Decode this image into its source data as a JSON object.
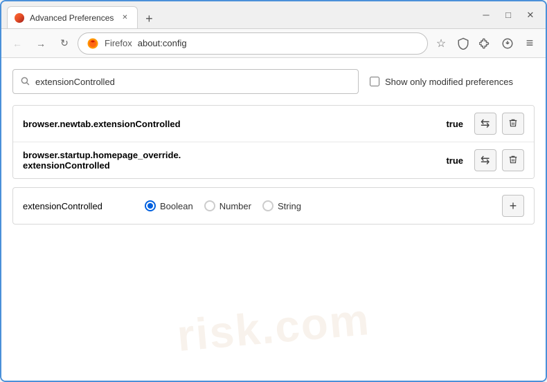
{
  "window": {
    "title": "Advanced Preferences",
    "close_label": "✕",
    "minimize_label": "─",
    "maximize_label": "□"
  },
  "tab": {
    "label": "Advanced Preferences",
    "close": "✕",
    "new_tab": "+"
  },
  "nav": {
    "back": "←",
    "forward": "→",
    "reload": "↻",
    "firefox_label": "Firefox",
    "url": "about:config",
    "bookmark_icon": "☆",
    "shield_icon": "🛡",
    "extension_icon": "🧩",
    "menu_icon": "≡"
  },
  "search": {
    "placeholder": "extensionControlled",
    "value": "extensionControlled",
    "show_modified_label": "Show only modified preferences"
  },
  "results": [
    {
      "name": "browser.newtab.extensionControlled",
      "value": "true"
    },
    {
      "name": "browser.startup.homepage_override.\nextensionControlled",
      "name_line1": "browser.startup.homepage_override.",
      "name_line2": "extensionControlled",
      "value": "true",
      "multiline": true
    }
  ],
  "new_pref": {
    "name": "extensionControlled",
    "types": [
      "Boolean",
      "Number",
      "String"
    ],
    "selected_type": "Boolean",
    "add_label": "+"
  },
  "actions": {
    "reset_icon": "⇄",
    "delete_icon": "🗑"
  },
  "watermark": {
    "line1": "risk.com",
    "line2": "risk.com"
  }
}
